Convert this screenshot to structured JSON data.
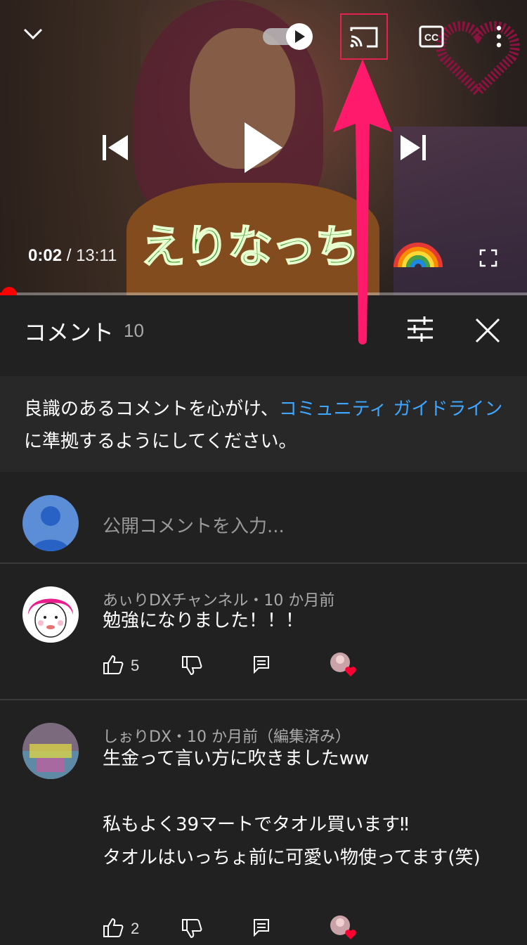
{
  "player": {
    "overlay_caption": "えりなっち",
    "time_current": "0:02",
    "time_separator": "/",
    "time_duration": "13:11",
    "progress_fraction": 0.0025
  },
  "colors": {
    "accent": "#ff0000",
    "link": "#3ea6ff",
    "highlight": "#e0244f",
    "arrow": "#ff1a6c"
  },
  "comments_panel": {
    "title": "コメント",
    "count": "10",
    "notice_before": "良識のあるコメントを心がけ、",
    "notice_link": "コミュニティ ガイドライン",
    "notice_after": "に準拠するようにしてください。",
    "input_placeholder": "公開コメントを入力..."
  },
  "comments": [
    {
      "author": "あぃりDXチャンネル",
      "time": "10 か月前",
      "meta": "あぃりDXチャンネル・10 か月前",
      "text": "勉強になりました！！！",
      "likes": "5"
    },
    {
      "author": "しぉりDX",
      "time": "10 か月前（編集済み）",
      "meta": "しぉりDX・10 か月前（編集済み）",
      "text": "生金って言い方に吹きましたww\n\n私もよく39マートでタオル買います‼︎\nタオルはいっちょ前に可愛い物使ってます(笑)",
      "likes": "2"
    }
  ]
}
